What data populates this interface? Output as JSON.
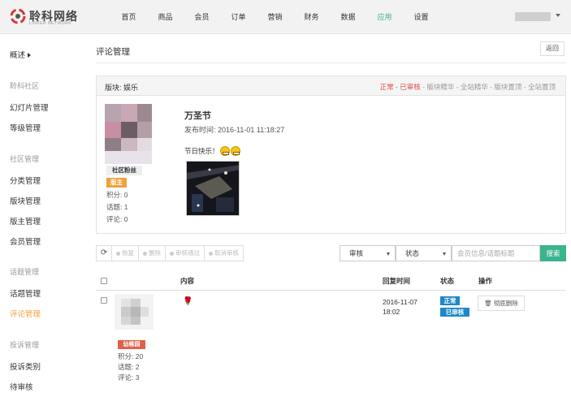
{
  "header": {
    "logo_text": "聆科网络",
    "logo_sub": "LINKER NETWORK",
    "nav": [
      "首页",
      "商品",
      "会员",
      "订单",
      "营销",
      "财务",
      "数据",
      "应用",
      "设置"
    ],
    "active_nav": "应用"
  },
  "sidebar": {
    "overview": "概述",
    "groups": [
      {
        "title": "聆科社区",
        "items": [
          "幻灯片管理",
          "等级管理"
        ]
      },
      {
        "title": "社区管理",
        "items": [
          "分类管理",
          "版块管理",
          "版主管理",
          "会员管理"
        ]
      },
      {
        "title": "话题管理",
        "items": [
          "话题管理",
          "评论管理"
        ]
      },
      {
        "title": "投诉管理",
        "items": [
          "投诉类别",
          "待审核"
        ]
      }
    ],
    "active_item": "评论管理"
  },
  "page": {
    "title": "评论管理",
    "back": "返回"
  },
  "topic": {
    "board": "版块: 娱乐",
    "status_normal": "正常",
    "status_reviewed": "已审核",
    "status_rest": "版块精华 - 全站精华 - 版块置顶 - 全站置顶",
    "sep": " - ",
    "fans_tag": "社区粉丝",
    "owner_tag": "版主",
    "points": "积分: 0",
    "topics": "话题: 1",
    "comments": "评论: 0",
    "title": "万圣节",
    "time": "发布时间: 2016-11-01 11:18:27",
    "text": "节日快乐！"
  },
  "toolbar": {
    "restore": "恢复",
    "delete": "删除",
    "approve": "审核通过",
    "cancel": "取消审核",
    "review_select": "审核",
    "status_select": "状态",
    "search_placeholder": "会员信息/话题标题",
    "search": "搜索"
  },
  "table": {
    "headers": {
      "content": "内容",
      "reply_time": "回复时间",
      "status": "状态",
      "action": "操作"
    },
    "rows": [
      {
        "user_tag": "幼稚园",
        "points": "积分: 20",
        "topics": "话题: 2",
        "comments": "评论: 3",
        "content_glyph": "🌹",
        "date": "2016-11-07",
        "time": "18:02",
        "badge_normal": "正常",
        "badge_reviewed": "已审核",
        "delete": "彻底删除"
      }
    ]
  },
  "colors": {
    "accent": "#3bb38f",
    "orange": "#f0a23b",
    "red": "#e04848",
    "blue": "#1e88c7"
  }
}
